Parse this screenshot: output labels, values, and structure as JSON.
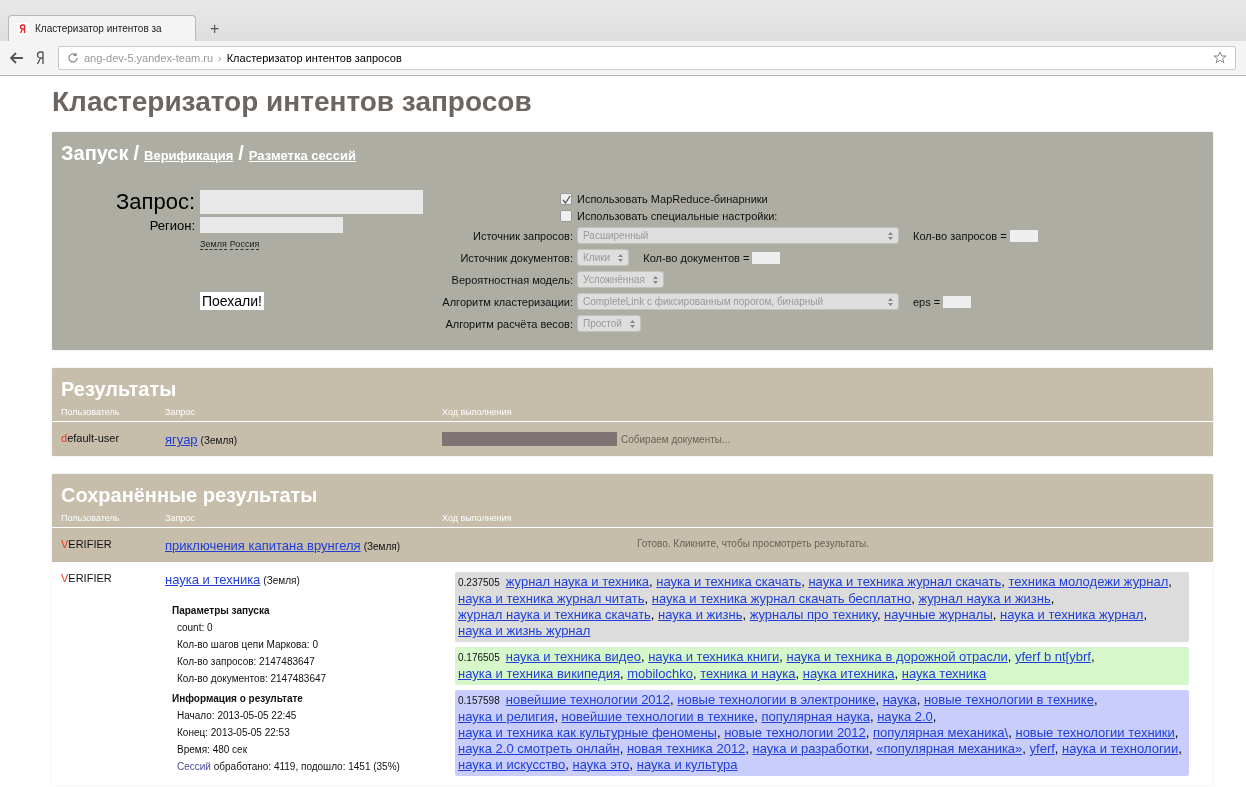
{
  "browser": {
    "tab_title": "Кластеризатор интентов за",
    "new_tab": "+",
    "url_host": "ang-dev-5.yandex-team.ru",
    "url_sep": "›",
    "url_title": "Кластеризатор интентов запросов"
  },
  "page_title": "Кластеризатор интентов запросов",
  "launch": {
    "nav": [
      {
        "label": "Запуск",
        "selected": true
      },
      {
        "label": "Верификация",
        "selected": false
      },
      {
        "label": "Разметка сессий",
        "selected": false
      }
    ],
    "nav_sep": "/",
    "query_label": "Запрос:",
    "region_label": "Регион:",
    "region_links": [
      "Земля",
      "Россия"
    ],
    "submit": "Поехали!",
    "checkboxes": [
      {
        "label": "Использовать MapReduce-бинарники",
        "checked": true
      },
      {
        "label": "Использовать специальные настройки:",
        "checked": false
      }
    ],
    "rows": [
      {
        "label": "Источник запросов:",
        "select": "Расширенный",
        "wide": true,
        "extra": "Кол-во запросов ="
      },
      {
        "label": "Источник документов:",
        "select": "Клики",
        "wide": false,
        "extra": "Кол-во документов ="
      },
      {
        "label": "Вероятностная модель:",
        "select": "Усложнённая",
        "wide": false
      },
      {
        "label": "Алгоритм кластеризации:",
        "select": "CompleteLink с фиксированным порогом, бинарный",
        "wide": true,
        "extra": "eps ="
      },
      {
        "label": "Алгоритм расчёта весов:",
        "select": "Простой",
        "wide": false
      }
    ]
  },
  "results": {
    "title": "Результаты",
    "columns": [
      "Пользователь",
      "Запрос",
      "Ход выполнения"
    ],
    "rows": [
      {
        "user": "default-user",
        "query": "ягуар",
        "region": "(Земля)",
        "status": "Собираем документы..."
      }
    ]
  },
  "saved": {
    "title": "Сохранённые результаты",
    "columns": [
      "Пользователь",
      "Запрос",
      "Ход выполнения"
    ],
    "rows": [
      {
        "kind": "done",
        "user": "VERIFIER",
        "query": "приключения капитана врунгеля",
        "region": "(Земля)",
        "status": "Готово. Кликните, чтобы просмотреть результаты."
      },
      {
        "kind": "expanded",
        "user": "VERIFIER",
        "query": "наука и техника",
        "region": "(Земля)",
        "sections": [
          {
            "title": "Параметры запуска",
            "lines": [
              "count: 0",
              "Кол-во шагов цепи Маркова: 0",
              "Кол-во запросов: 2147483647",
              "Кол-во документов: 2147483647"
            ]
          },
          {
            "title": "Информация о результате",
            "lines": [
              "Начало: 2013-05-05 22:45",
              "Конец: 2013-05-05 22:53",
              "Время: 480 сек"
            ]
          }
        ],
        "session_link": "Сессий",
        "session_text": "обработано: 4119, подошло: 1451 (35%)",
        "separator": ",",
        "clusters": [
          {
            "score": "0.237505",
            "color": "#dcdcdc",
            "queries": [
              "журнал наука и техника",
              "наука и техника скачать",
              "наука и техника журнал скачать",
              "техника молодежи журнал",
              "наука и техника журнал читать",
              "наука и техника журнал скачать бесплатно",
              "журнал наука и жизнь",
              "журнал наука и техника скачать",
              "наука и жизнь",
              "журналы про технику",
              "научные журналы",
              "наука и техника журнал",
              "наука и жизнь журнал"
            ]
          },
          {
            "score": "0.176505",
            "color": "#d6f7c9",
            "queries": [
              "наука и техника видео",
              "наука и техника книги",
              "наука и техника в дорожной отрасли",
              "yferf b nt[ybrf",
              "наука и техника википедия",
              "mobilochko",
              "техника и наука",
              "наука итехника",
              "наука техника"
            ]
          },
          {
            "score": "0.157598",
            "color": "#c9cdfc",
            "queries": [
              "новейшие технологии 2012",
              "новые технологии в электронике",
              "наука",
              "новые технологии в технике",
              "наука и религия",
              "новейшие технологии в технике",
              "популярная наука",
              "наука 2.0",
              "наука и техника как культурные феномены",
              "новые технологии 2012",
              "популярная механика\\",
              "новые технологии техники",
              "наука 2.0 смотреть онлайн",
              "новая техника 2012",
              "наука и разработки",
              "«популярная механика»",
              "yferf",
              "наука и технологии",
              "наука и искусство",
              "наука это",
              "наука и культура"
            ]
          }
        ]
      }
    ]
  }
}
